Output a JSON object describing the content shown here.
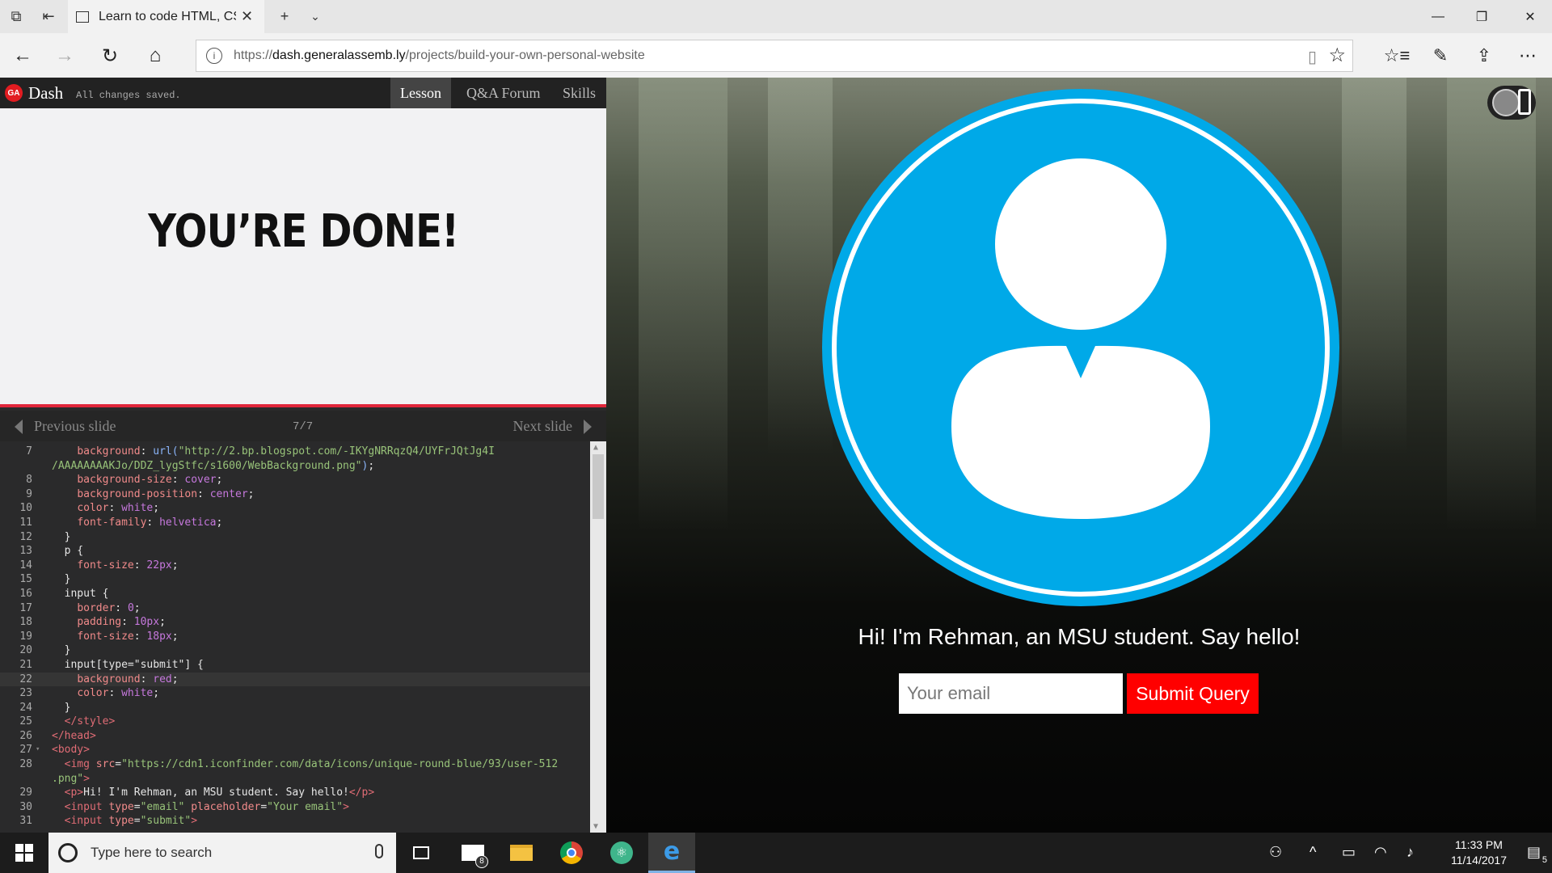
{
  "browser": {
    "tab_title": "Learn to code HTML, CS",
    "url_prefix": "https://",
    "url_host": "dash.generalassemb.ly",
    "url_path": "/projects/build-your-own-personal-website"
  },
  "dash": {
    "logo_text": "GA",
    "title": "Dash",
    "saved_status": "All changes saved.",
    "tabs": [
      {
        "label": "Lesson"
      },
      {
        "label": "Q&A Forum"
      },
      {
        "label": "Skills"
      }
    ],
    "slide_heading": "YOU’RE DONE!",
    "prev_label": "Previous slide",
    "next_label": "Next slide",
    "slide_counter": "7/7"
  },
  "editor": {
    "lines": [
      {
        "n": "7",
        "fold": "",
        "html": "    <span class=\"kw\">background</span>: <span class=\"url\">url(</span><span class=\"str\">\"http://2.bp.blogspot.com/-IKYgNRRqzQ4/UYFrJQtJg4I</span>"
      },
      {
        "n": "",
        "fold": "",
        "html": "<span class=\"str\">/AAAAAAAAKJo/DDZ_lygStfc/s1600/WebBackground.png\"</span><span class=\"url\">)</span>;"
      },
      {
        "n": "8",
        "fold": "",
        "html": "    <span class=\"kw\">background-size</span>: <span class=\"val\">cover</span>;"
      },
      {
        "n": "9",
        "fold": "",
        "html": "    <span class=\"kw\">background-position</span>: <span class=\"val\">center</span>;"
      },
      {
        "n": "10",
        "fold": "",
        "html": "    <span class=\"kw\">color</span>: <span class=\"val\">white</span>;"
      },
      {
        "n": "11",
        "fold": "",
        "html": "    <span class=\"kw\">font-family</span>: <span class=\"val\">helvetica</span>;"
      },
      {
        "n": "12",
        "fold": "",
        "html": "  }"
      },
      {
        "n": "13",
        "fold": "",
        "html": "  p {"
      },
      {
        "n": "14",
        "fold": "",
        "html": "    <span class=\"kw\">font-size</span>: <span class=\"val\">22px</span>;"
      },
      {
        "n": "15",
        "fold": "",
        "html": "  }"
      },
      {
        "n": "16",
        "fold": "",
        "html": "  input {"
      },
      {
        "n": "17",
        "fold": "",
        "html": "    <span class=\"kw\">border</span>: <span class=\"val\">0</span>;"
      },
      {
        "n": "18",
        "fold": "",
        "html": "    <span class=\"kw\">padding</span>: <span class=\"val\">10px</span>;"
      },
      {
        "n": "19",
        "fold": "",
        "html": "    <span class=\"kw\">font-size</span>: <span class=\"val\">18px</span>;"
      },
      {
        "n": "20",
        "fold": "",
        "html": "  }"
      },
      {
        "n": "21",
        "fold": "",
        "html": "  input[type=\"submit\"] {"
      },
      {
        "n": "22",
        "fold": "",
        "html": "    <span class=\"kw\">background</span>: <span class=\"val\">red</span>;",
        "active": true
      },
      {
        "n": "23",
        "fold": "",
        "html": "    <span class=\"kw\">color</span>: <span class=\"val\">white</span>;"
      },
      {
        "n": "24",
        "fold": "",
        "html": "  }"
      },
      {
        "n": "25",
        "fold": "",
        "html": "  <span class=\"tag\">&lt;/style&gt;</span>"
      },
      {
        "n": "26",
        "fold": "",
        "html": "<span class=\"tag\">&lt;/head&gt;</span>"
      },
      {
        "n": "27",
        "fold": "▾",
        "html": "<span class=\"tag\">&lt;body&gt;</span>"
      },
      {
        "n": "28",
        "fold": "",
        "html": "  <span class=\"tag\">&lt;img</span> <span class=\"kw\">src</span>=<span class=\"str\">\"https://cdn1.iconfinder.com/data/icons/unique-round-blue/93/user-512</span>"
      },
      {
        "n": "",
        "fold": "",
        "html": "<span class=\"str\">.png\"</span><span class=\"tag\">&gt;</span>"
      },
      {
        "n": "29",
        "fold": "",
        "html": "  <span class=\"tag\">&lt;p&gt;</span>Hi! I'm Rehman, an MSU student. Say hello!<span class=\"tag\">&lt;/p&gt;</span>"
      },
      {
        "n": "30",
        "fold": "",
        "html": "  <span class=\"tag\">&lt;input</span> <span class=\"kw\">type</span>=<span class=\"str\">\"email\"</span> <span class=\"kw\">placeholder</span>=<span class=\"str\">\"Your email\"</span><span class=\"tag\">&gt;</span>"
      },
      {
        "n": "31",
        "fold": "",
        "html": "  <span class=\"tag\">&lt;input</span> <span class=\"kw\">type</span>=<span class=\"str\">\"submit\"</span><span class=\"tag\">&gt;</span>"
      }
    ]
  },
  "preview": {
    "hello_text": "Hi! I'm Rehman, an MSU student. Say hello!",
    "email_placeholder": "Your email",
    "submit_label": "Submit Query",
    "avatar_color": "#00a9e8",
    "submit_color": "#ff0000"
  },
  "taskbar": {
    "search_placeholder": "Type here to search",
    "mail_badge": "8",
    "time": "11:33 PM",
    "date": "11/14/2017",
    "notification_count": "5"
  }
}
